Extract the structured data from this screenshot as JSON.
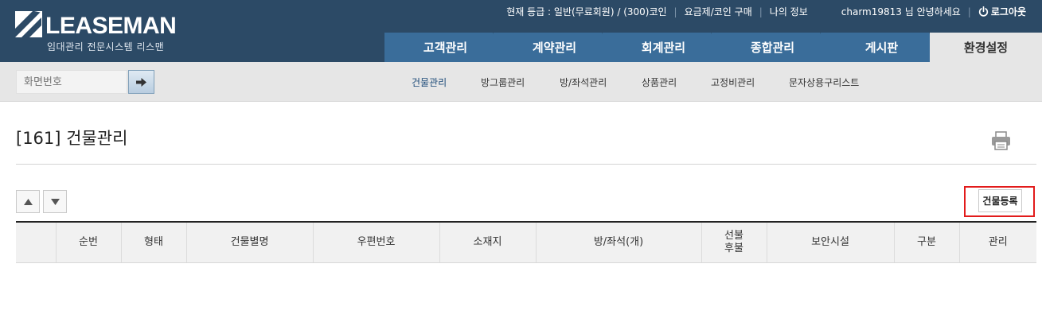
{
  "logo": {
    "name": "LEASEMAN",
    "subtitle": "임대관리 전문시스템 리스맨"
  },
  "topinfo": {
    "grade": "현재 등급 : 일반(무료회원) / (300)코인",
    "plan": "요금제/코인 구매",
    "myinfo": "나의 정보",
    "greeting": "charm19813 님 안녕하세요",
    "logout": "로그아웃"
  },
  "tabs": [
    "고객관리",
    "계약관리",
    "회계관리",
    "종합관리",
    "게시판",
    "환경설정"
  ],
  "search": {
    "placeholder": "화면번호"
  },
  "submenu": [
    "건물관리",
    "방그룹관리",
    "방/좌석관리",
    "상품관리",
    "고정비관리",
    "문자상용구리스트"
  ],
  "page": {
    "title": "[161] 건물관리",
    "register_label": "건물등록"
  },
  "table": {
    "columns": [
      "",
      "순번",
      "형태",
      "건물별명",
      "우편번호",
      "소재지",
      "방/좌석(개)",
      "선불 후불",
      "보안시설",
      "구분",
      "관리"
    ]
  },
  "colors": {
    "header_bg": "#2c4a66",
    "tab_bg": "#3a6d9a",
    "highlight": "#e21b1b"
  }
}
